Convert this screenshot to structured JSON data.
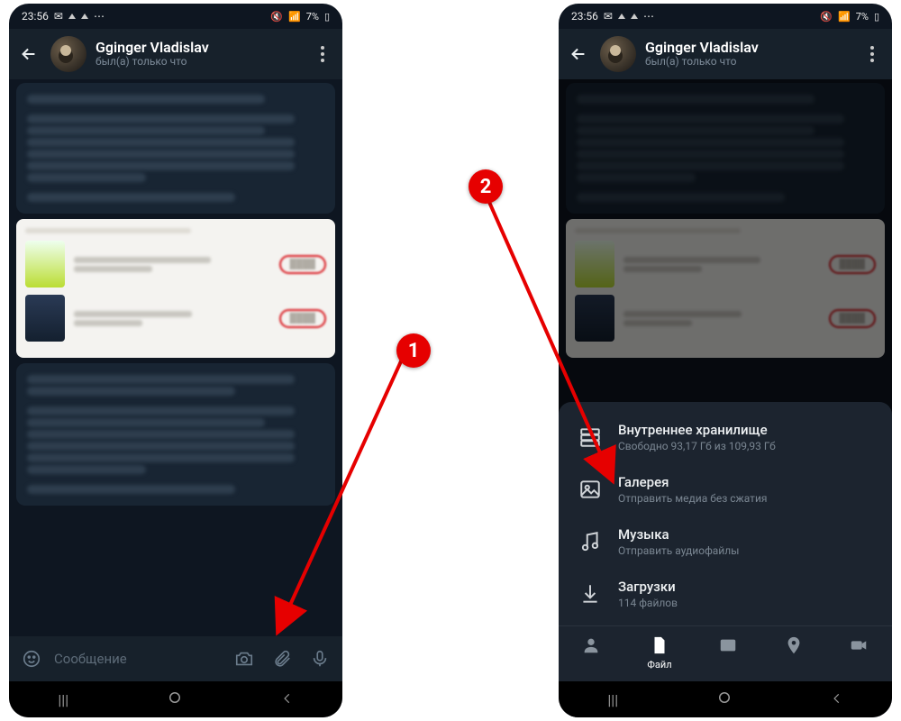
{
  "status": {
    "time": "23:56",
    "battery": "7%"
  },
  "chat": {
    "name": "Gginger Vladislav",
    "subtitle": "был(а) только что"
  },
  "input": {
    "placeholder": "Сообщение"
  },
  "attach_sheet": {
    "items": [
      {
        "title": "Внутреннее хранилище",
        "subtitle": "Свободно 93,17 Гб из 109,93 Гб",
        "icon": "storage-icon"
      },
      {
        "title": "Галерея",
        "subtitle": "Отправить медиа без сжатия",
        "icon": "gallery-icon"
      },
      {
        "title": "Музыка",
        "subtitle": "Отправить аудиофайлы",
        "icon": "music-icon"
      },
      {
        "title": "Загрузки",
        "subtitle": "114 файлов",
        "icon": "downloads-icon"
      }
    ],
    "tabs": {
      "contact": "",
      "file": "Файл",
      "gallery": "",
      "location": "",
      "video": ""
    }
  },
  "annotations": {
    "b1": "1",
    "b2": "2"
  }
}
